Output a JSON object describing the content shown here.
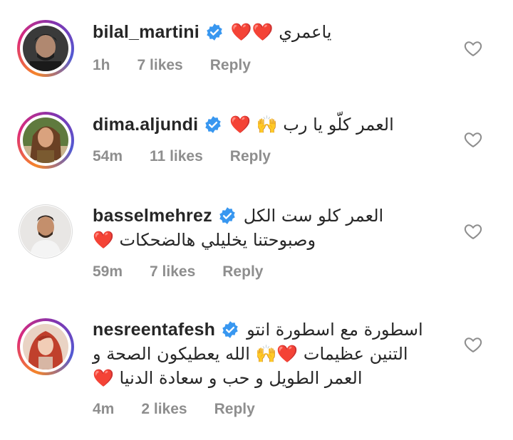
{
  "comments": [
    {
      "username": "bilal_martini",
      "lines": [
        "ياعمري ❤️❤️"
      ],
      "time": "1h",
      "likes": "7 likes",
      "reply": "Reply"
    },
    {
      "username": "dima.aljundi",
      "lines": [
        "العمر كلّو يا رب 🙌 ❤️"
      ],
      "time": "54m",
      "likes": "11 likes",
      "reply": "Reply"
    },
    {
      "username": "basselmehrez",
      "lines": [
        "العمر كلو ست الكل",
        "وصبوحتنا يخليلي هالضحكات ❤️"
      ],
      "time": "59m",
      "likes": "7 likes",
      "reply": "Reply"
    },
    {
      "username": "nesreentafesh",
      "lines": [
        "اسطورة مع اسطورة انتو",
        "التنين عظيمات ❤️🙌 الله يعطيكون الصحة و",
        "العمر الطويل و حب و سعادة الدنيا ❤️"
      ],
      "time": "4m",
      "likes": "2 likes",
      "reply": "Reply"
    }
  ],
  "icons": {
    "verified": "verified-badge-icon",
    "like": "heart-outline-icon",
    "raised_hands": "raised-hands-emoji",
    "heart": "red-heart-emoji"
  },
  "colors": {
    "verified_blue": "#3897f0",
    "heart_red": "#e0262f",
    "meta_gray": "#8e8e8e",
    "text": "#262626"
  }
}
